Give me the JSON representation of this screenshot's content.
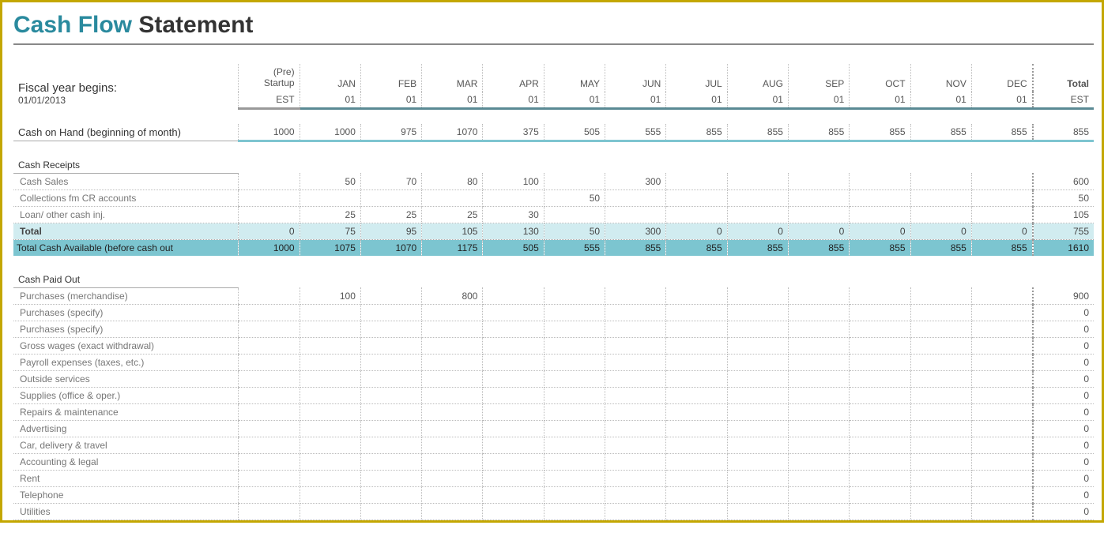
{
  "title": {
    "cash_flow": "Cash Flow",
    "statement": " Statement"
  },
  "header": {
    "fiscal_label": "Fiscal year begins:",
    "fiscal_date": "01/01/2013",
    "pre_startup_line1": "(Pre)",
    "pre_startup_line2": "Startup",
    "pre_startup_est": "EST",
    "months": [
      "JAN",
      "FEB",
      "MAR",
      "APR",
      "MAY",
      "JUN",
      "JUL",
      "AUG",
      "SEP",
      "OCT",
      "NOV",
      "DEC"
    ],
    "month_sub": "01",
    "total_label": "Total",
    "total_sub": "EST"
  },
  "cash_on_hand": {
    "label": "Cash on Hand (beginning of month)",
    "pre": "1000",
    "vals": [
      "1000",
      "975",
      "1070",
      "375",
      "505",
      "555",
      "855",
      "855",
      "855",
      "855",
      "855",
      "855"
    ],
    "total": "855"
  },
  "cash_receipts": {
    "title": "Cash Receipts",
    "rows": [
      {
        "label": "Cash Sales",
        "pre": "",
        "vals": [
          "50",
          "70",
          "80",
          "100",
          "",
          "300",
          "",
          "",
          "",
          "",
          "",
          ""
        ],
        "total": "600"
      },
      {
        "label": "Collections fm CR accounts",
        "pre": "",
        "vals": [
          "",
          "",
          "",
          "",
          "50",
          "",
          "",
          "",
          "",
          "",
          "",
          ""
        ],
        "total": "50"
      },
      {
        "label": "Loan/ other cash inj.",
        "pre": "",
        "vals": [
          "25",
          "25",
          "25",
          "30",
          "",
          "",
          "",
          "",
          "",
          "",
          "",
          ""
        ],
        "total": "105"
      }
    ],
    "total_row": {
      "label": "Total",
      "pre": "0",
      "vals": [
        "75",
        "95",
        "105",
        "130",
        "50",
        "300",
        "0",
        "0",
        "0",
        "0",
        "0",
        "0"
      ],
      "total": "755"
    },
    "available_row": {
      "label": "Total Cash Available (before cash out",
      "pre": "1000",
      "vals": [
        "1075",
        "1070",
        "1175",
        "505",
        "555",
        "855",
        "855",
        "855",
        "855",
        "855",
        "855",
        "855"
      ],
      "total": "1610"
    }
  },
  "cash_paid_out": {
    "title": "Cash Paid Out",
    "rows": [
      {
        "label": "Purchases (merchandise)",
        "pre": "",
        "vals": [
          "100",
          "",
          "800",
          "",
          "",
          "",
          "",
          "",
          "",
          "",
          "",
          ""
        ],
        "total": "900"
      },
      {
        "label": "Purchases (specify)",
        "pre": "",
        "vals": [
          "",
          "",
          "",
          "",
          "",
          "",
          "",
          "",
          "",
          "",
          "",
          ""
        ],
        "total": "0"
      },
      {
        "label": "Purchases (specify)",
        "pre": "",
        "vals": [
          "",
          "",
          "",
          "",
          "",
          "",
          "",
          "",
          "",
          "",
          "",
          ""
        ],
        "total": "0"
      },
      {
        "label": "Gross wages (exact withdrawal)",
        "pre": "",
        "vals": [
          "",
          "",
          "",
          "",
          "",
          "",
          "",
          "",
          "",
          "",
          "",
          ""
        ],
        "total": "0"
      },
      {
        "label": "Payroll expenses (taxes, etc.)",
        "pre": "",
        "vals": [
          "",
          "",
          "",
          "",
          "",
          "",
          "",
          "",
          "",
          "",
          "",
          ""
        ],
        "total": "0"
      },
      {
        "label": "Outside services",
        "pre": "",
        "vals": [
          "",
          "",
          "",
          "",
          "",
          "",
          "",
          "",
          "",
          "",
          "",
          ""
        ],
        "total": "0"
      },
      {
        "label": "Supplies (office & oper.)",
        "pre": "",
        "vals": [
          "",
          "",
          "",
          "",
          "",
          "",
          "",
          "",
          "",
          "",
          "",
          ""
        ],
        "total": "0"
      },
      {
        "label": "Repairs & maintenance",
        "pre": "",
        "vals": [
          "",
          "",
          "",
          "",
          "",
          "",
          "",
          "",
          "",
          "",
          "",
          ""
        ],
        "total": "0"
      },
      {
        "label": "Advertising",
        "pre": "",
        "vals": [
          "",
          "",
          "",
          "",
          "",
          "",
          "",
          "",
          "",
          "",
          "",
          ""
        ],
        "total": "0"
      },
      {
        "label": "Car, delivery & travel",
        "pre": "",
        "vals": [
          "",
          "",
          "",
          "",
          "",
          "",
          "",
          "",
          "",
          "",
          "",
          ""
        ],
        "total": "0"
      },
      {
        "label": "Accounting & legal",
        "pre": "",
        "vals": [
          "",
          "",
          "",
          "",
          "",
          "",
          "",
          "",
          "",
          "",
          "",
          ""
        ],
        "total": "0"
      },
      {
        "label": "Rent",
        "pre": "",
        "vals": [
          "",
          "",
          "",
          "",
          "",
          "",
          "",
          "",
          "",
          "",
          "",
          ""
        ],
        "total": "0"
      },
      {
        "label": "Telephone",
        "pre": "",
        "vals": [
          "",
          "",
          "",
          "",
          "",
          "",
          "",
          "",
          "",
          "",
          "",
          ""
        ],
        "total": "0"
      },
      {
        "label": "Utilities",
        "pre": "",
        "vals": [
          "",
          "",
          "",
          "",
          "",
          "",
          "",
          "",
          "",
          "",
          "",
          ""
        ],
        "total": "0"
      }
    ]
  }
}
